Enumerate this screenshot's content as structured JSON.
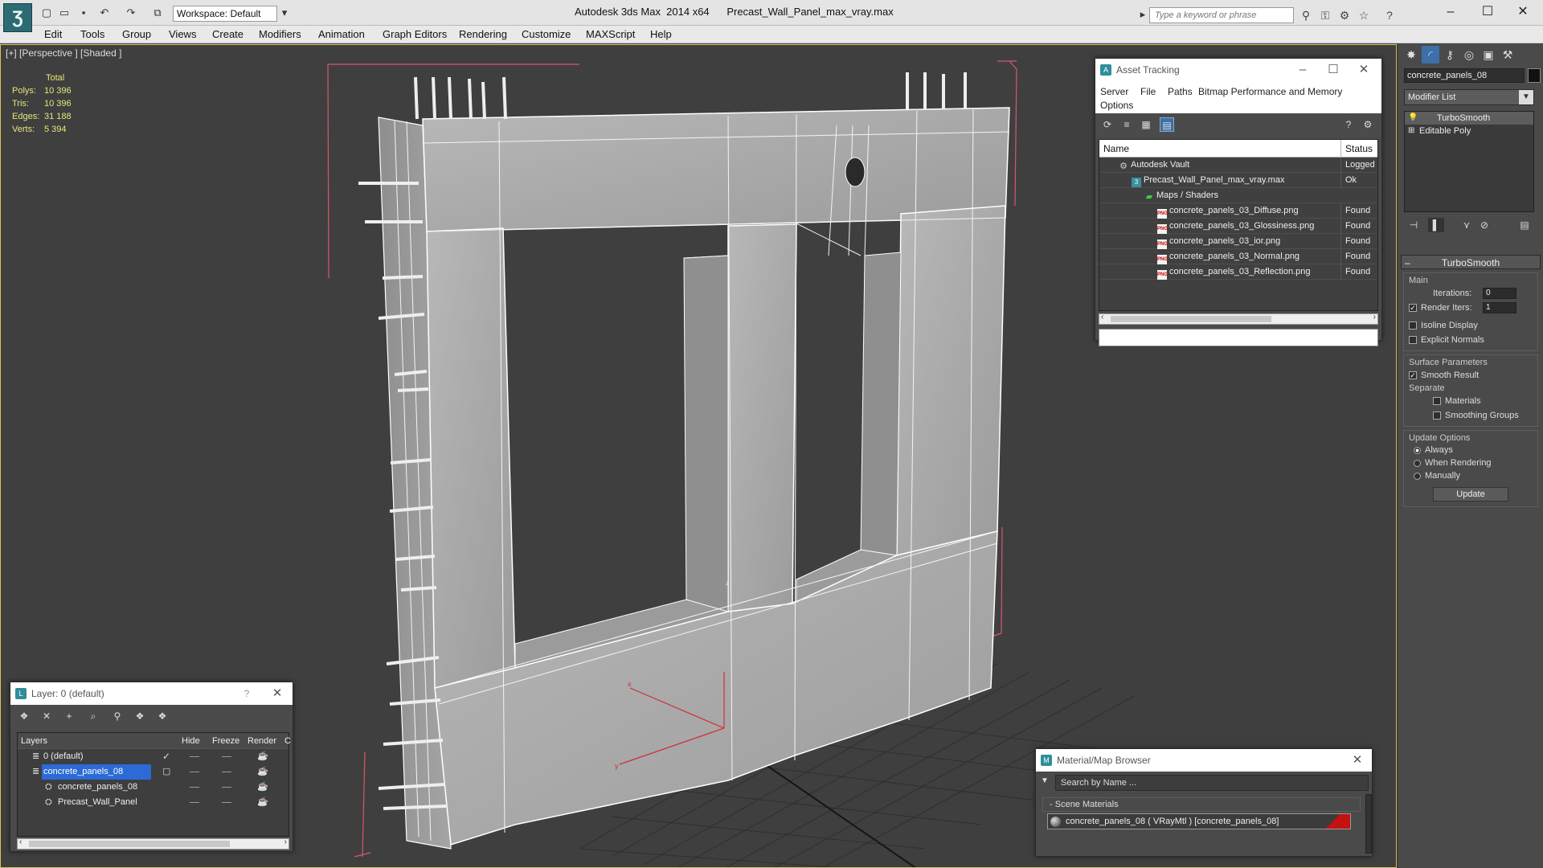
{
  "app": {
    "title": "Autodesk 3ds Max  2014 x64      Precast_Wall_Panel_max_vray.max",
    "workspace": "Workspace: Default",
    "search_placeholder": "Type a keyword or phrase"
  },
  "menu": [
    "Edit",
    "Tools",
    "Group",
    "Views",
    "Create",
    "Modifiers",
    "Animation",
    "Graph Editors",
    "Rendering",
    "Customize",
    "MAXScript",
    "Help"
  ],
  "viewport": {
    "label": "[+] [Perspective ] [Shaded ]",
    "stats": {
      "header": "Total",
      "rows": [
        {
          "label": "Polys:",
          "value": "10 396"
        },
        {
          "label": "Tris:",
          "value": "10 396"
        },
        {
          "label": "Edges:",
          "value": "31 188"
        },
        {
          "label": "Verts:",
          "value": "5 394"
        }
      ]
    },
    "axis_x": "x",
    "axis_y": "y",
    "axis_z": "z"
  },
  "command_panel": {
    "object_name": "concrete_panels_08",
    "modifier_list": "Modifier List",
    "stack": [
      "TurboSmooth",
      "Editable Poly"
    ],
    "rollout_title": "TurboSmooth",
    "main_label": "Main",
    "iterations_label": "Iterations:",
    "iterations_value": "0",
    "render_iters_label": "Render Iters:",
    "render_iters_value": "1",
    "isoline_display": "Isoline Display",
    "explicit_normals": "Explicit Normals",
    "surface_parameters": "Surface Parameters",
    "smooth_result": "Smooth Result",
    "separate": "Separate",
    "materials": "Materials",
    "smoothing_groups": "Smoothing Groups",
    "update_options": "Update Options",
    "always": "Always",
    "when_rendering": "When Rendering",
    "manually": "Manually",
    "update_button": "Update"
  },
  "asset_tracking": {
    "title": "Asset Tracking",
    "menu": [
      "Server",
      "File",
      "Paths",
      "Bitmap Performance and Memory",
      "Options"
    ],
    "columns": [
      "Name",
      "Status"
    ],
    "rows": [
      {
        "name": "Autodesk Vault",
        "status": "Logged Out",
        "icon": "vault-icon"
      },
      {
        "name": "Precast_Wall_Panel_max_vray.max",
        "status": "Ok",
        "icon": "max-file-icon"
      },
      {
        "name": "Maps / Shaders",
        "status": "",
        "icon": "maps-icon"
      },
      {
        "name": "concrete_panels_03_Diffuse.png",
        "status": "Found",
        "icon": "png-icon"
      },
      {
        "name": "concrete_panels_03_Glossiness.png",
        "status": "Found",
        "icon": "png-icon"
      },
      {
        "name": "concrete_panels_03_ior.png",
        "status": "Found",
        "icon": "png-icon"
      },
      {
        "name": "concrete_panels_03_Normal.png",
        "status": "Found",
        "icon": "png-icon"
      },
      {
        "name": "concrete_panels_03_Reflection.png",
        "status": "Found",
        "icon": "png-icon"
      }
    ]
  },
  "layer_window": {
    "title": "Layer: 0 (default)",
    "help": "?",
    "columns": [
      "Layers",
      "Hide",
      "Freeze",
      "Render",
      "C"
    ],
    "rows": [
      {
        "name": "0 (default)",
        "selected": false
      },
      {
        "name": "concrete_panels_08",
        "selected": true
      },
      {
        "name": "concrete_panels_08",
        "selected": false
      },
      {
        "name": "Precast_Wall_Panel",
        "selected": false
      }
    ]
  },
  "material_browser": {
    "title": "Material/Map Browser",
    "search_placeholder": "Search by Name ...",
    "section": "Scene Materials",
    "item": "concrete_panels_08  ( VRayMtl ) [concrete_panels_08]"
  },
  "colors": {
    "viewport_bg": "#3f3f3f",
    "panel_bg": "#4a4a4a",
    "selection": "#2c6bd6",
    "stats_text": "#e6e67a",
    "bbox": "#d8576b"
  }
}
